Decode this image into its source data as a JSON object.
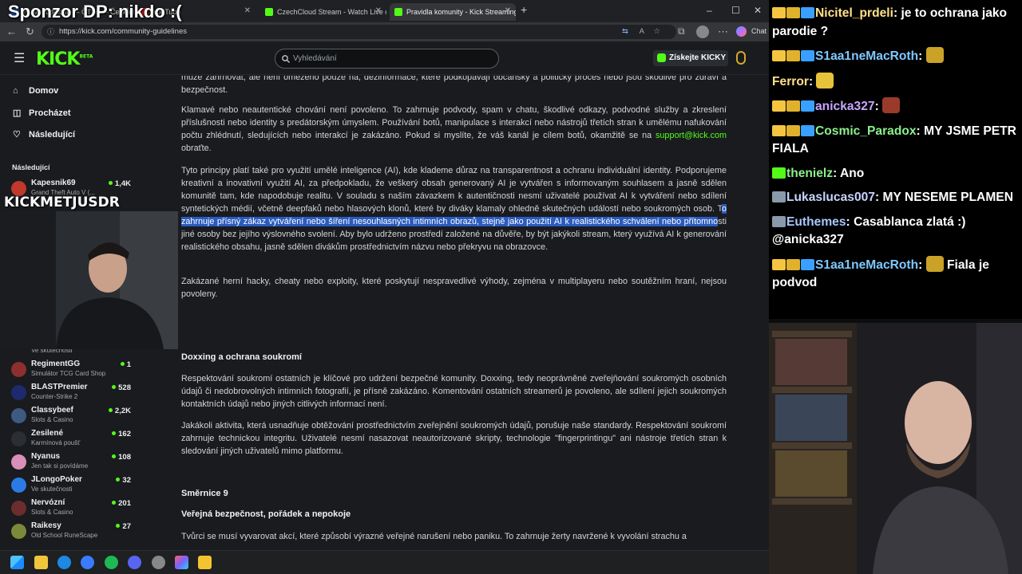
{
  "overlay": {
    "sponsor_text": "Sponzor DP: nikdo :(",
    "cam_label": "KICKMETJUSDR"
  },
  "browser": {
    "tabs": [
      {
        "label": "Hlavní události — ČT24 — Česká televize",
        "active": false
      },
      {
        "label": "YouTube",
        "active": false
      },
      {
        "label": "CzechCloud Stream - Watch Live on Kick",
        "active": false
      },
      {
        "label": "Pravidla komunity - Kick Streaming",
        "active": true
      }
    ],
    "new_tab": "+",
    "window_controls": [
      "–",
      "☐",
      "✕"
    ],
    "url": "https://kick.com/community-guidelines",
    "chat_button": "Chat"
  },
  "kick": {
    "logo": "KICK",
    "logo_badge": "BETA",
    "search_placeholder": "Vyhledávání",
    "get_kicky": "Získejte KICKY",
    "nav": [
      {
        "label": "Domov",
        "icon": "home-icon"
      },
      {
        "label": "Procházet",
        "icon": "browse-icon"
      },
      {
        "label": "Následující",
        "icon": "heart-icon"
      }
    ],
    "following_heading": "Následující",
    "following": [
      {
        "name": "Kapesnik69",
        "game": "Grand Theft Auto V (...",
        "viewers": "1,4K",
        "color": "#c0392b"
      },
      {
        "name": "",
        "game": "Ve skutečnosti",
        "viewers": "",
        "color": "#555"
      },
      {
        "name": "RegimentGG",
        "game": "Simulátor TCG Card Shop",
        "viewers": "1",
        "color": "#8e2f2f"
      },
      {
        "name": "BLASTPremier",
        "game": "Counter-Strike 2",
        "viewers": "528",
        "color": "#1e2a6e"
      },
      {
        "name": "Classybeef",
        "game": "Slots & Casino",
        "viewers": "2,2K",
        "color": "#3d5a80"
      },
      {
        "name": "Zesilené",
        "game": "Karmínová poušť",
        "viewers": "162",
        "color": "#2b2e33"
      },
      {
        "name": "Nyanus",
        "game": "Jen tak si povídáme",
        "viewers": "108",
        "color": "#d98fb8"
      },
      {
        "name": "JLongoPoker",
        "game": "Ve skutečnosti",
        "viewers": "32",
        "color": "#2c7be5"
      },
      {
        "name": "Nervózní",
        "game": "Slots & Casino",
        "viewers": "201",
        "color": "#6b2d2d"
      },
      {
        "name": "Raikesy",
        "game": "Old School RuneScape",
        "viewers": "27",
        "color": "#7a8a3a"
      }
    ],
    "content": {
      "p0_a": "může zahrnovat, ale není omezeno pouze na, dezinformace, které podkopávají občanský a politický proces nebo jsou škodlivé pro",
      "p0_b": "zdraví a bezpečnost.",
      "p1": "Klamavé nebo neautentické chování není povoleno. To zahrnuje podvody, spam v chatu, škodlivé odkazy, podvodné služby a zkreslení příslušnosti nebo identity s predátorským úmyslem. Používání botů, manipulace s interakcí nebo nástrojů třetích stran k umělému nafukování počtu zhlédnutí, sledujících nebo interakcí je zakázáno. Pokud si myslíte, že váš kanál je cílem botů, okamžitě se na",
      "p1_link": "support@kick.com",
      "p1_end": " obraťte.",
      "p2_a": "Tyto principy platí také pro využití umělé inteligence (AI), kde klademe důraz na transparentnost a ochranu individuální identity. Podporujeme kreativní a inovativní využití AI, za předpokladu, že veškerý obsah generovaný AI je vytvářen s informovaným souhlasem a jasně sdělen komunitě tam, kde napodobuje realitu. V souladu s naším závazkem k autentičnosti nesmí uživatelé používat AI k vytváření nebo sdílení syntetických médií, včetně deepfaků nebo hlasových klonů, které by diváky klamaly ohledně skutečných událostí nebo soukromých osob. T",
      "p2_hl": "o zahrnuje přísný zákaz vytváření nebo šíření nesouhlasných intimních obrazů, stejně jako použití AI k realistického schválení nebo přítomno",
      "p2_b": "sti jiné osoby bez jejího výslovného svolení. Aby bylo udrženo prostředí založené na důvěře, by být jakýkoli stream, který využívá AI k generování realistického obsahu, jasně sdělen divákům prostřednictvím názvu nebo překryvu na obrazovce.",
      "p3": "Zakázané herní hacky, cheaty nebo exploity, které poskytují nespravedlivé výhody, zejména v multiplayeru nebo soutěžním hraní, nejsou povoleny.",
      "h_doxxing": "Doxxing a ochrana soukromí",
      "p4": "Respektování soukromí ostatních je klíčové pro udržení bezpečné komunity. Doxxing, tedy neoprávněné zveřejňování soukromých osobních údajů či nedobrovolných intimních fotografií, je přísně zakázáno. Komentování ostatních streamerů je povoleno, ale sdílení jejich soukromých kontaktních údajů nebo jiných citlivých informací není.",
      "p5": "Jakákoli aktivita, která usnadňuje obtěžování prostřednictvím zveřejnění soukromých údajů, porušuje naše standardy. Respektování soukromí zahrnuje technickou integritu. Uživatelé nesmí nasazovat neautorizované skripty, technologie \"fingerprintingu\" ani nástroje třetích stran k sledování jiných uživatelů mimo platformu.",
      "h_smernice": "Směrnice 9",
      "h_verejna": "Veřejná bezpečnost, pořádek a nepokoje",
      "p6": "Tvůrci se musí vyvarovat akcí, které způsobí výrazné veřejné narušení nebo paniku. To zahrnuje žerty navržené k vyvolání strachu a"
    }
  },
  "chat": [
    {
      "user": "Nicitel_prdeli",
      "color": "#ffe08a",
      "text": " je to ochrana jako parodie ?",
      "badges": [
        "#f5c542",
        "#e0b22c",
        "#3aa0ff"
      ],
      "emote": ""
    },
    {
      "user": "S1aa1neMacRoth",
      "color": "#7fc8ff",
      "text": "",
      "badges": [
        "#f5c542",
        "#e0b22c",
        "#3aa0ff"
      ],
      "emote": "#c9a227"
    },
    {
      "user": "Ferror",
      "color": "#ffe08a",
      "text": "",
      "badges": [],
      "emote": "#e8c23a"
    },
    {
      "user": "anicka327",
      "color": "#c7a6ff",
      "text": "",
      "badges": [
        "#f5c542",
        "#e0b22c",
        "#3aa0ff"
      ],
      "emote": "#9a3b2a"
    },
    {
      "user": "Cosmic_Paradox",
      "color": "#8cf08c",
      "text": " MY JSME PETR FIALA",
      "badges": [
        "#f5c542",
        "#e0b22c",
        "#3aa0ff"
      ],
      "emote": ""
    },
    {
      "user": "thenielz",
      "color": "#8cf08c",
      "text": " Ano",
      "badges": [
        "#53fc18"
      ],
      "emote": ""
    },
    {
      "user": "Lukaslucas007",
      "color": "#c7d4ff",
      "text": " MY NESEME PLAMEN",
      "badges": [
        "#8899aa"
      ],
      "emote": ""
    },
    {
      "user": "Euthemes",
      "color": "#a7c7ff",
      "text": " Casablanca zlatá :) @anicka327",
      "badges": [
        "#8899aa"
      ],
      "emote": ""
    },
    {
      "user": "S1aa1neMacRoth",
      "color": "#7fc8ff",
      "text": " Fiala je podvod",
      "badges": [
        "#f5c542",
        "#e0b22c",
        "#3aa0ff"
      ],
      "emote": "#c9a227"
    }
  ]
}
